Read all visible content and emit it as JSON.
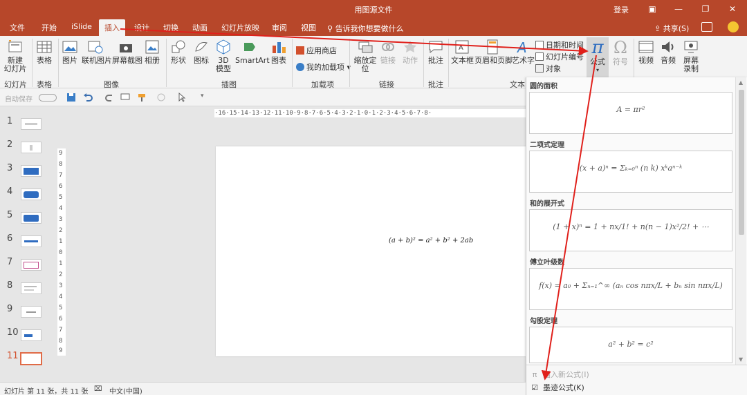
{
  "window": {
    "title": "用图源文件",
    "login": "登录",
    "accent_color": "#b7472a"
  },
  "tabs": [
    "文件",
    "开始",
    "iSlide",
    "插入",
    "设计",
    "切换",
    "动画",
    "幻灯片放映",
    "审阅",
    "视图"
  ],
  "active_tab": "插入",
  "tell_me": "告诉我你想要做什么",
  "share_label": "共享(S)",
  "ribbon": {
    "new_slide": "新建\n幻灯片",
    "group_slides": "幻灯片",
    "table": "表格",
    "group_table": "表格",
    "picture": "图片",
    "online_picture": "联机图片",
    "screenshot": "屏幕截图",
    "album": "相册",
    "group_images": "图像",
    "shapes": "形状",
    "icons": "图标",
    "model3d": "3D\n模型",
    "smartart": "SmartArt",
    "chart": "图表",
    "group_illustrations": "插图",
    "store": "应用商店",
    "my_addins": "我的加载项",
    "group_addins": "加载项",
    "zoom": "缩放定\n位",
    "link": "链接",
    "action": "动作",
    "group_links": "链接",
    "comment": "批注",
    "group_comments": "批注",
    "textbox": "文本框",
    "header_footer": "页眉和页脚",
    "wordart": "艺术字",
    "datetime": "日期和时间",
    "slide_number": "幻灯片编号",
    "object": "对象",
    "group_text": "文本",
    "equation": "公式",
    "symbol": "符号",
    "video": "视频",
    "audio": "音频",
    "screen_record": "屏幕\n录制"
  },
  "qat": {
    "autosave": "自动保存"
  },
  "ruler": {
    "horizontal": "·16·15·14·13·12·11·10·9·8·7·6·5·4·3·2·1·0·1·2·3·4·5·6·7·8·",
    "vertical": [
      "9",
      "8",
      "7",
      "6",
      "5",
      "4",
      "3",
      "2",
      "1",
      "0",
      "1",
      "2",
      "3",
      "4",
      "5",
      "6",
      "7",
      "8",
      "9"
    ]
  },
  "thumbnails": [
    "1",
    "2",
    "3",
    "4",
    "5",
    "6",
    "7",
    "8",
    "9",
    "10",
    "11"
  ],
  "active_slide": "11",
  "slide": {
    "equation": "(a + b)² = a² + b² + 2ab"
  },
  "gallery": {
    "sections": [
      {
        "title": "圆的面积",
        "equation": "A = πr²"
      },
      {
        "title": "二项式定理",
        "equation": "(x + a)ⁿ = Σₖ₌₀ⁿ (n k) xᵏaⁿ⁻ᵏ"
      },
      {
        "title": "和的展开式",
        "equation": "(1 + x)ⁿ = 1 + nx/1! + n(n − 1)x²/2! + ⋯"
      },
      {
        "title": "傅立叶级数",
        "equation": "f(x) = a₀ + Σₙ₌₁^∞ (aₙ cos nπx/L + bₙ sin nπx/L)"
      },
      {
        "title": "勾股定理",
        "equation": "a² + b² = c²"
      }
    ],
    "insert_new": "插入新公式(I)",
    "ink_equation": "墨迹公式(K)"
  },
  "status": {
    "slide_info": "幻灯片 第 11 张，共 11 张",
    "language": "中文(中国)"
  }
}
